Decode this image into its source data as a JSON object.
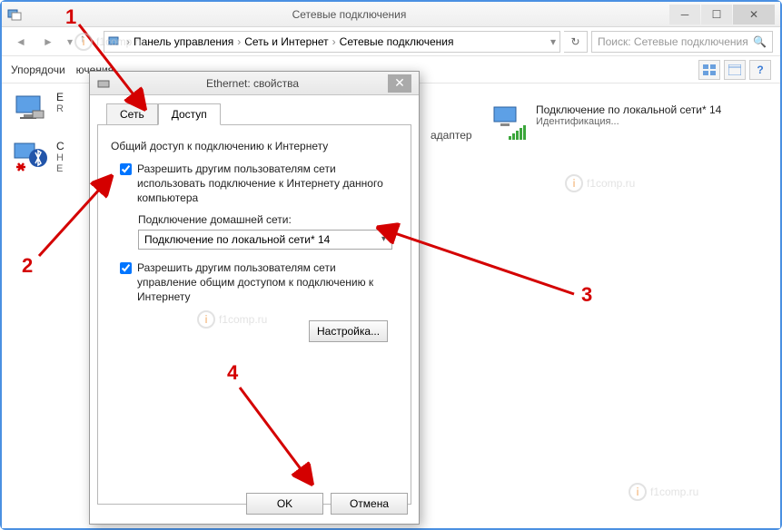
{
  "window": {
    "title": "Сетевые подключения",
    "breadcrumbs": [
      "Панель управления",
      "Сеть и Интернет",
      "Сетевые подключения"
    ],
    "search_placeholder": "Поиск: Сетевые подключения",
    "organize": "Упорядочи"
  },
  "connections": {
    "ethernet": {
      "line1": "E",
      "line2": "R"
    },
    "bluetooth": {
      "line1": "С",
      "line2": "Н",
      "line3": "E"
    },
    "localwifi": {
      "line1": "Подключение по локальной сети* 14",
      "line2": "Идентификация..."
    },
    "adapter_frag": "адаптер",
    "header_frag": "ючения"
  },
  "dialog": {
    "title": "Ethernet: свойства",
    "tabs": {
      "net": "Сеть",
      "access": "Доступ"
    },
    "group": "Общий доступ к подключению к Интернету",
    "chk1": "Разрешить другим пользователям сети использовать подключение к Интернету данного компьютера",
    "home_net_label": "Подключение домашней сети:",
    "combo_value": "Подключение по локальной сети* 14",
    "chk2": "Разрешить другим пользователям сети управление общим доступом к подключению к Интернету",
    "settings_btn": "Настройка...",
    "ok": "OK",
    "cancel": "Отмена"
  },
  "annotations": {
    "n1": "1",
    "n2": "2",
    "n3": "3",
    "n4": "4"
  },
  "watermark": "f1comp.ru"
}
